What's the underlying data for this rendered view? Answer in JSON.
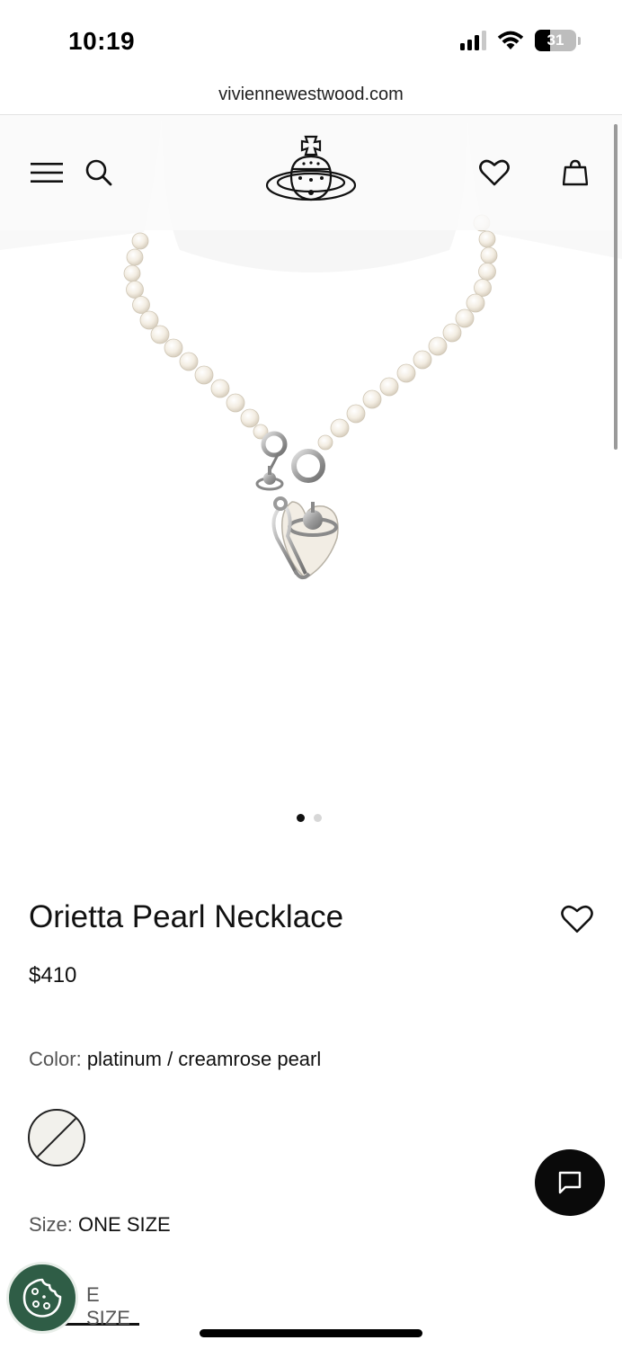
{
  "status_bar": {
    "time": "10:19",
    "battery_level": "31"
  },
  "browser": {
    "url": "viviennewestwood.com"
  },
  "header": {
    "menu_icon": "hamburger-menu-icon",
    "search_icon": "search-icon",
    "logo_icon": "orb-logo-icon",
    "wishlist_icon": "heart-icon",
    "bag_icon": "shopping-bag-icon"
  },
  "gallery": {
    "slide_count": 2,
    "active_slide": 1
  },
  "product": {
    "title": "Orietta Pearl Necklace",
    "price": "$410",
    "color_label": "Color:",
    "color_value": "platinum / creamrose pearl",
    "size_label": "Size:",
    "size_value": "ONE SIZE",
    "size_option_visible": "E SIZE"
  },
  "floating": {
    "chat_icon": "chat-bubble-icon",
    "cookie_icon": "cookie-icon"
  },
  "colors": {
    "text": "#111111",
    "cookie_button": "#2f5d46",
    "chat_button": "#0a0a0a",
    "hero_bg": "#f8f8f8"
  }
}
